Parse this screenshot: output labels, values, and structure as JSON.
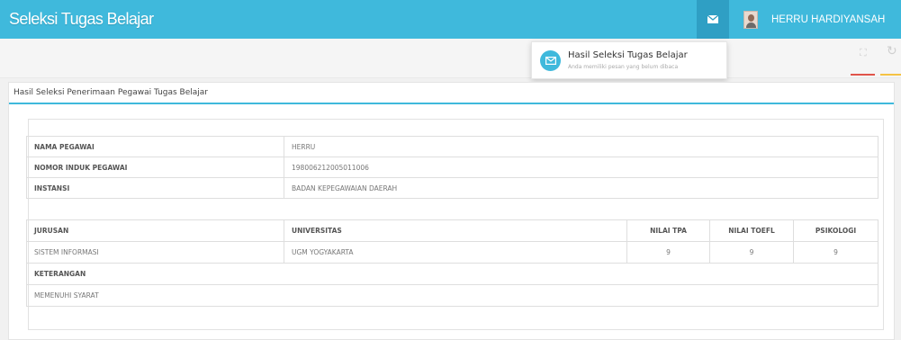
{
  "app": {
    "title": "Seleksi Tugas Belajar",
    "user_name": "HERRU HARDIYANSAH"
  },
  "notification": {
    "title": "Hasil Seleksi Tugas Belajar",
    "subtitle": "Anda memiliki pesan yang belum dibaca"
  },
  "panel": {
    "title": "Hasil Seleksi Penerimaan Pegawai Tugas Belajar"
  },
  "employee": [
    {
      "label": "NAMA PEGAWAI",
      "value": "HERRU"
    },
    {
      "label": "NOMOR INDUK PEGAWAI",
      "value": "198006212005011006"
    },
    {
      "label": "INSTANSI",
      "value": "BADAN KEPEGAWAIAN DAERAH"
    }
  ],
  "education": {
    "headers": [
      "JURUSAN",
      "UNIVERSITAS",
      "NILAI TPA",
      "NILAI TOEFL",
      "PSIKOLOGI"
    ],
    "row": [
      "SISTEM INFORMASI",
      "UGM YOGYAKARTA",
      "9",
      "9",
      "9"
    ]
  },
  "keterangan": {
    "label": "KETERANGAN",
    "value": "MEMENUHI SYARAT"
  },
  "icons": {
    "mail": "envelope-icon",
    "notification": "envelope-circle-icon",
    "expand": "expand-icon",
    "refresh": "refresh-icon"
  },
  "colors": {
    "primary": "#3fb9dc",
    "primary_dark": "#2f9fc4",
    "accent_red": "#e0544a",
    "accent_yellow": "#f5c344"
  }
}
